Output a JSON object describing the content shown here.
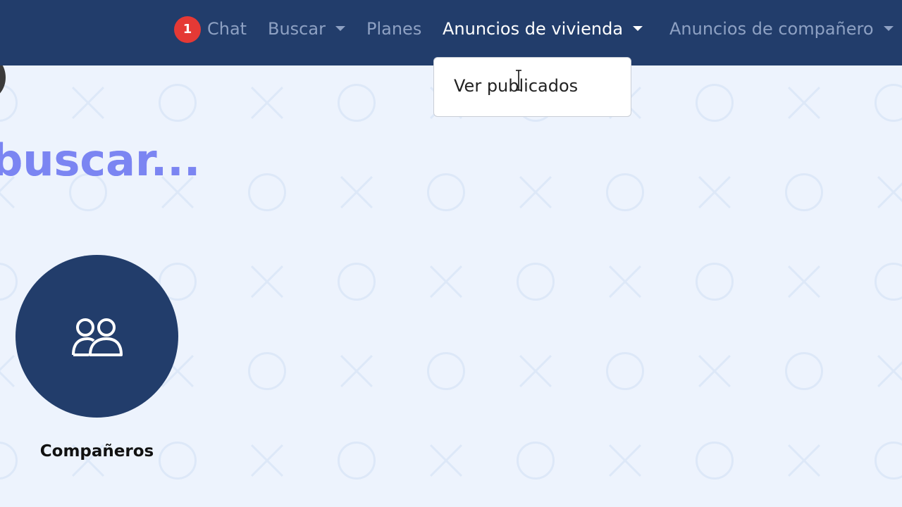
{
  "navbar": {
    "chat_badge": "1",
    "chat_label": "Chat",
    "buscar_label": "Buscar",
    "planes_label": "Planes",
    "anuncios_vivienda_label": "Anuncios de vivienda",
    "anuncios_companero_label": "Anuncios de compañero"
  },
  "dropdown": {
    "items": [
      "Ver publicados"
    ]
  },
  "main": {
    "heading": "buscar...",
    "cards": [
      {
        "label": "Compañeros",
        "icon": "users-icon"
      }
    ]
  },
  "colors": {
    "navbar_bg": "#223d6b",
    "page_bg": "#edf3fd",
    "badge": "#e53935",
    "heading_gradient_start": "#6a79ff",
    "heading_gradient_end": "#8a7fe8"
  }
}
